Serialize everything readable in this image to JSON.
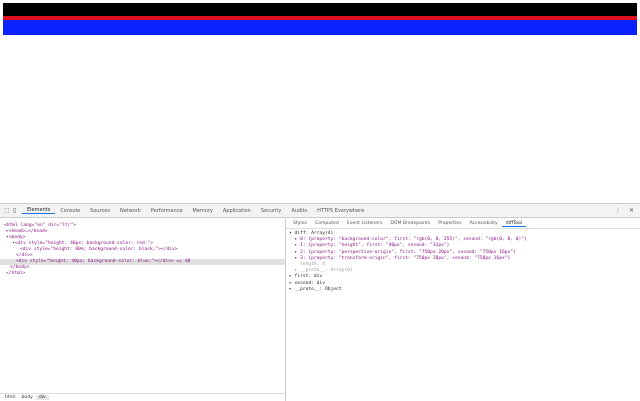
{
  "tabs": [
    "Elements",
    "Console",
    "Sources",
    "Network",
    "Performance",
    "Memory",
    "Application",
    "Security",
    "Audits",
    "HTTPS Everywhere"
  ],
  "dom": {
    "l0": "<html lang=\"en\" dir=\"ltr\">",
    "l1": "▸<head>…</head>",
    "l2": "▾<body>",
    "l3": "▾<div style=\"height: 40px; background-color: red;\">",
    "l4": "<div style=\"height: 80%; background-color: black;\"></div>",
    "l5": "</div>",
    "l6": "<div style=\"height: 40px; background-color: blue;\"></div> == $0",
    "l7": "</body>",
    "l8": "</html>"
  },
  "side_tabs": [
    "Styles",
    "Computed",
    "Event Listeners",
    "DOM Breakpoints",
    "Properties",
    "Accessibility",
    "diffTool"
  ],
  "console": [
    "▾ diff: Array(4)",
    "  ▸ 0: {property: \"background-color\", first: \"rgb(0, 0, 255)\", second: \"rgb(0, 0, 0)\"}",
    "  ▸ 1: {property: \"height\", first: \"40px\", second: \"32px\"}",
    "  ▸ 2: {property: \"perspective-origin\", first: \"750px 20px\", second: \"750px 16px\"}",
    "  ▸ 3: {property: \"transform-origin\", first: \"750px 20px\", second: \"750px 16px\"}",
    "    length: 4",
    "  ▸ __proto__: Array(0)",
    "▸ first: div",
    "▸ second: div",
    "▸ __proto__: Object"
  ],
  "crumbs": [
    "html",
    "body",
    "div"
  ]
}
